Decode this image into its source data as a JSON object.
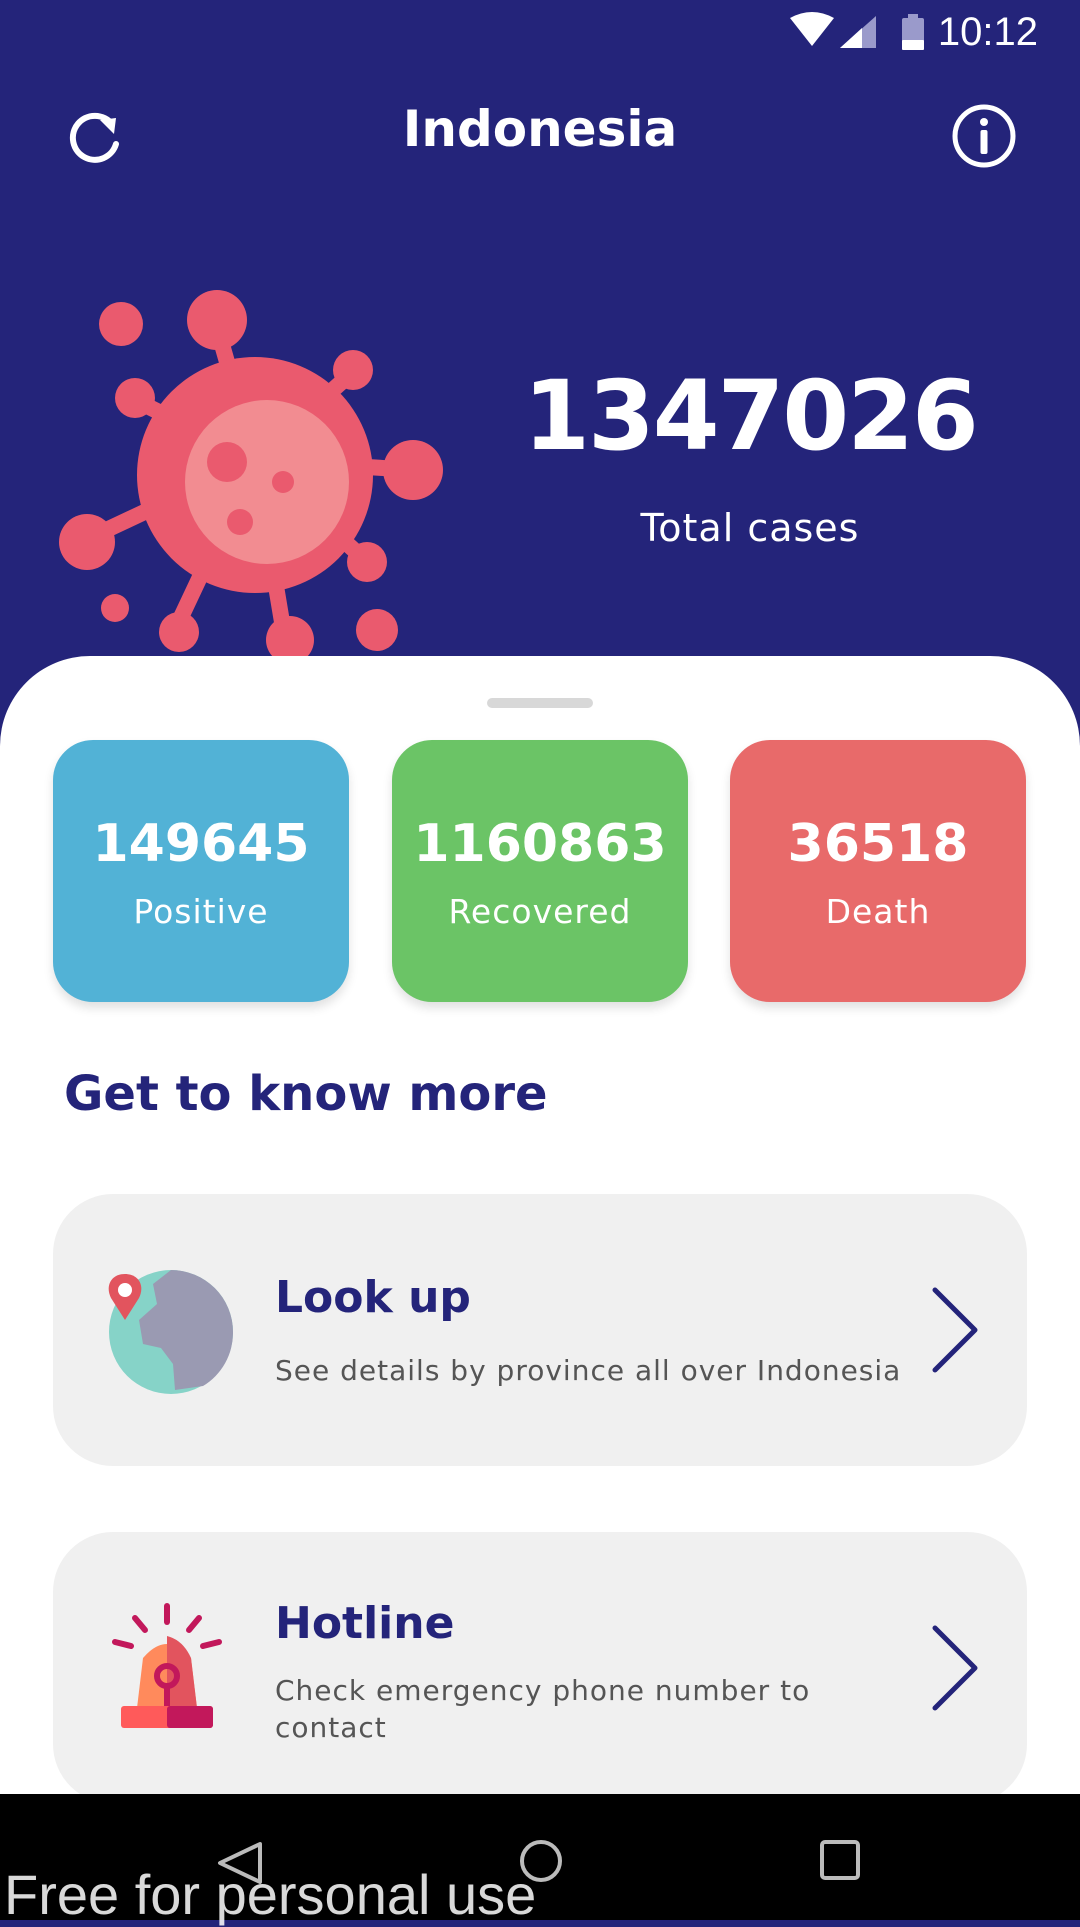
{
  "status_bar": {
    "time": "10:12",
    "icons": [
      "wifi-icon",
      "signal-icon",
      "battery-icon"
    ]
  },
  "header": {
    "title": "Indonesia",
    "left_icon": "refresh-icon",
    "right_icon": "info-icon"
  },
  "hero": {
    "total_cases": "1347026",
    "total_label": "Total cases"
  },
  "stats": [
    {
      "value": "149645",
      "label": "Positive",
      "color": "#52b2d6"
    },
    {
      "value": "1160863",
      "label": "Recovered",
      "color": "#6bc466"
    },
    {
      "value": "36518",
      "label": "Death",
      "color": "#e86a6a"
    }
  ],
  "section_title": "Get to know more",
  "menu": [
    {
      "title": "Look up",
      "description": "See details by province all over Indonesia",
      "icon": "globe-pin-icon"
    },
    {
      "title": "Hotline",
      "description": "Check emergency phone number to contact",
      "icon": "siren-icon"
    }
  ],
  "watermark": "Free for personal use",
  "colors": {
    "primary": "#24247a",
    "virus": "#ea5a6e",
    "card_bg": "#f0f0f0"
  }
}
